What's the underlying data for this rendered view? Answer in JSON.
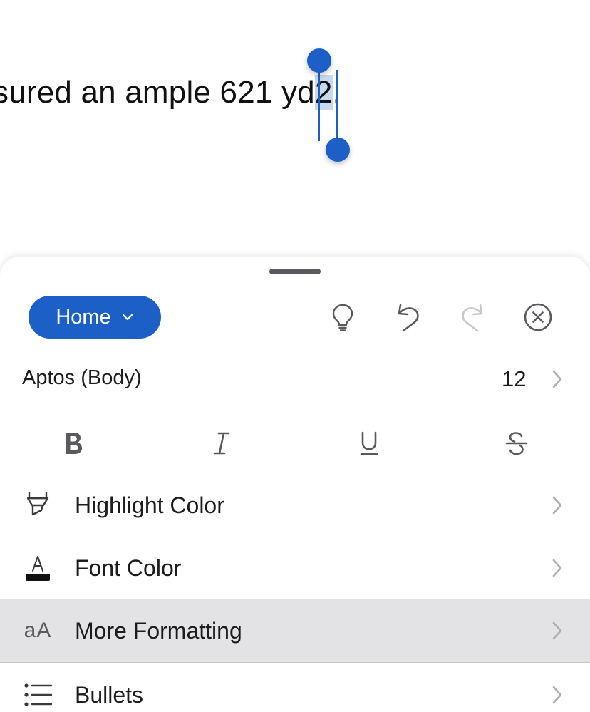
{
  "document": {
    "text_before": "sured an ample 621 yd",
    "text_selected": "2",
    "text_after": "."
  },
  "toolbar": {
    "home_label": "Home",
    "icons": [
      "lightbulb-icon",
      "undo-icon",
      "redo-icon",
      "close-icon"
    ]
  },
  "font": {
    "name": "Aptos (Body)",
    "size": "12"
  },
  "styles": [
    "bold",
    "italic",
    "underline",
    "strikethrough"
  ],
  "menu": {
    "highlight_label": "Highlight Color",
    "font_color_label": "Font Color",
    "more_formatting_label": "More Formatting",
    "more_formatting_icon_text": "aA",
    "bullets_label": "Bullets"
  },
  "colors": {
    "accent": "#1c5fc7",
    "selection": "#c8d9ee",
    "pressed_row": "#e3e3e5"
  }
}
